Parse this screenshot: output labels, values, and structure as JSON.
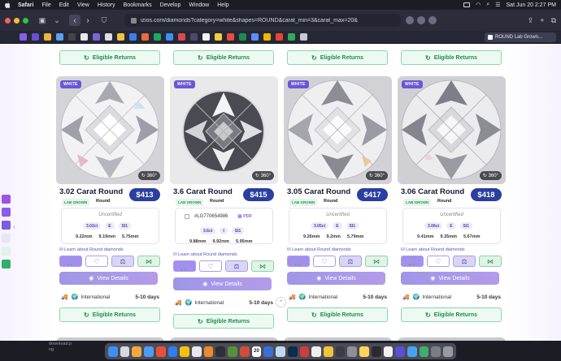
{
  "menubar": {
    "items": [
      "Safari",
      "File",
      "Edit",
      "View",
      "History",
      "Bookmarks",
      "Develop",
      "Window",
      "Help"
    ],
    "clock": "Sat Jun 20  2:27 PM"
  },
  "toolbar": {
    "url": "izios.com/diamonds?category=white&shapes=ROUND&carat_min=3&carat_max=20&",
    "active_tab": "ROUND Lab Grown..."
  },
  "colors": {
    "accent": "#2a3f9f",
    "green": "#1f8c4d",
    "purple": "#6a57d4"
  },
  "labels": {
    "eligible_returns": "Eligible Returns",
    "view_details": "View Details",
    "learn_more": "Learn about Round diamonds",
    "shipping": "International",
    "shipping_days": "5-10 days",
    "badge": "WHITE",
    "rotate": "360°",
    "lab_grown": "LAB GROWN",
    "uncertified": "Uncertified",
    "pdf": "PDF"
  },
  "products": [
    {
      "title": "3.02 Carat Round",
      "price": "$413",
      "shape": "Round",
      "certified": false,
      "carat": "3.02ct",
      "color": "E",
      "clarity": "SI1",
      "dims": [
        "9.22mm",
        "9.19mm",
        "5.75mm"
      ]
    },
    {
      "title": "3.6 Carat Round",
      "price": "$415",
      "shape": "Round",
      "certified": true,
      "cert_no": "#LG770654986",
      "carat": "3.6ct",
      "color": "I",
      "clarity": "SI1",
      "dims": [
        "9.88mm",
        "9.92mm",
        "5.95mm"
      ]
    },
    {
      "title": "3.05 Carat Round",
      "price": "$417",
      "shape": "Round",
      "certified": false,
      "carat": "3.05ct",
      "color": "E",
      "clarity": "SI1",
      "dims": [
        "9.26mm",
        "9.2mm",
        "5.79mm"
      ]
    },
    {
      "title": "3.06 Carat Round",
      "price": "$418",
      "shape": "Round",
      "certified": false,
      "carat": "3.06ct",
      "color": "E",
      "clarity": "SI1",
      "dims": [
        "9.41mm",
        "9.35mm",
        "5.67mm"
      ]
    }
  ],
  "dock": {
    "download_label": "download.p\nng",
    "calendar_day": "20"
  }
}
